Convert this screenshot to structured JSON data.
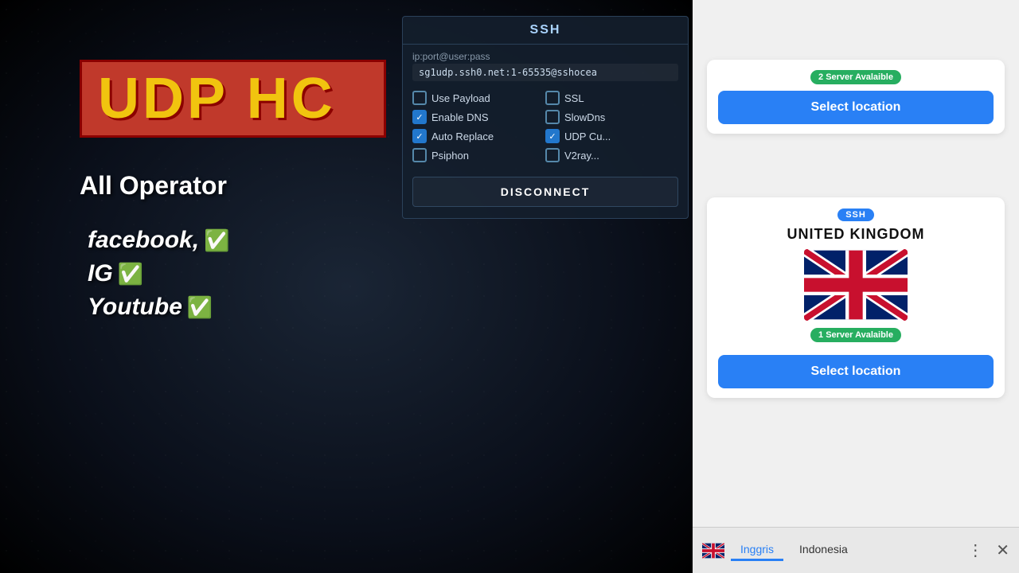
{
  "app": {
    "title": "UDP HC"
  },
  "left_panel": {
    "logo_text": "UDP HC",
    "all_operator": "All Operator",
    "social_items": [
      {
        "text": "facebook,",
        "check": "✅"
      },
      {
        "text": "IG",
        "check": "✅"
      },
      {
        "text": "Youtube",
        "check": "✅"
      }
    ]
  },
  "ssh_panel": {
    "title": "SSH",
    "label_format": "ip:port@user:pass",
    "value": "sg1udp.ssh0.net:1-65535@sshocea",
    "options": [
      {
        "id": "use-payload",
        "label": "Use Payload",
        "checked": false
      },
      {
        "id": "ssl",
        "label": "SSL",
        "checked": false
      },
      {
        "id": "enable-dns",
        "label": "Enable DNS",
        "checked": true
      },
      {
        "id": "slowdns",
        "label": "SlowDns",
        "checked": false
      },
      {
        "id": "auto-replace",
        "label": "Auto Replace",
        "checked": true
      },
      {
        "id": "udp-custom",
        "label": "UDP Cu...",
        "checked": true
      },
      {
        "id": "psiphon",
        "label": "Psiphon",
        "checked": false
      },
      {
        "id": "v2ray",
        "label": "V2ray...",
        "checked": false
      }
    ],
    "disconnect_label": "DISCONNECT"
  },
  "right_panel": {
    "card1": {
      "server_count": "2 Server Avalaible",
      "select_label": "Select location"
    },
    "card2": {
      "ssh_badge": "SSH",
      "country": "UNITED KINGDOM",
      "server_count": "1 Server Avalaible",
      "select_label": "Select location"
    }
  },
  "bottom_bar": {
    "lang1": "Inggris",
    "lang2": "Indonesia",
    "more_icon": "⋮",
    "close_icon": "✕"
  }
}
